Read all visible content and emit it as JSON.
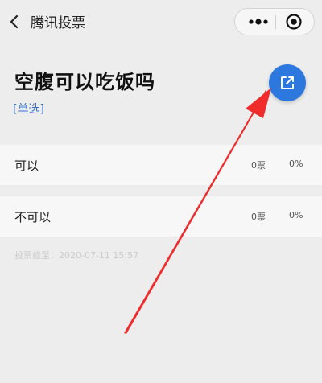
{
  "navbar": {
    "back_icon": "chevron-left-icon",
    "title": "腾讯投票",
    "more_icon": "more-dots-icon",
    "close_icon": "target-close-icon"
  },
  "vote": {
    "title": "空腹可以吃饭吗",
    "type": "[单选]",
    "share_icon": "share-external-icon",
    "accent": "#2c78de"
  },
  "options": [
    {
      "label": "可以",
      "count": "0票",
      "percent": "0%"
    },
    {
      "label": "不可以",
      "count": "0票",
      "percent": "0%"
    }
  ],
  "deadline": "投票截至：2020-07-11 15:57",
  "annotation": {
    "color": "#f02b2b"
  }
}
